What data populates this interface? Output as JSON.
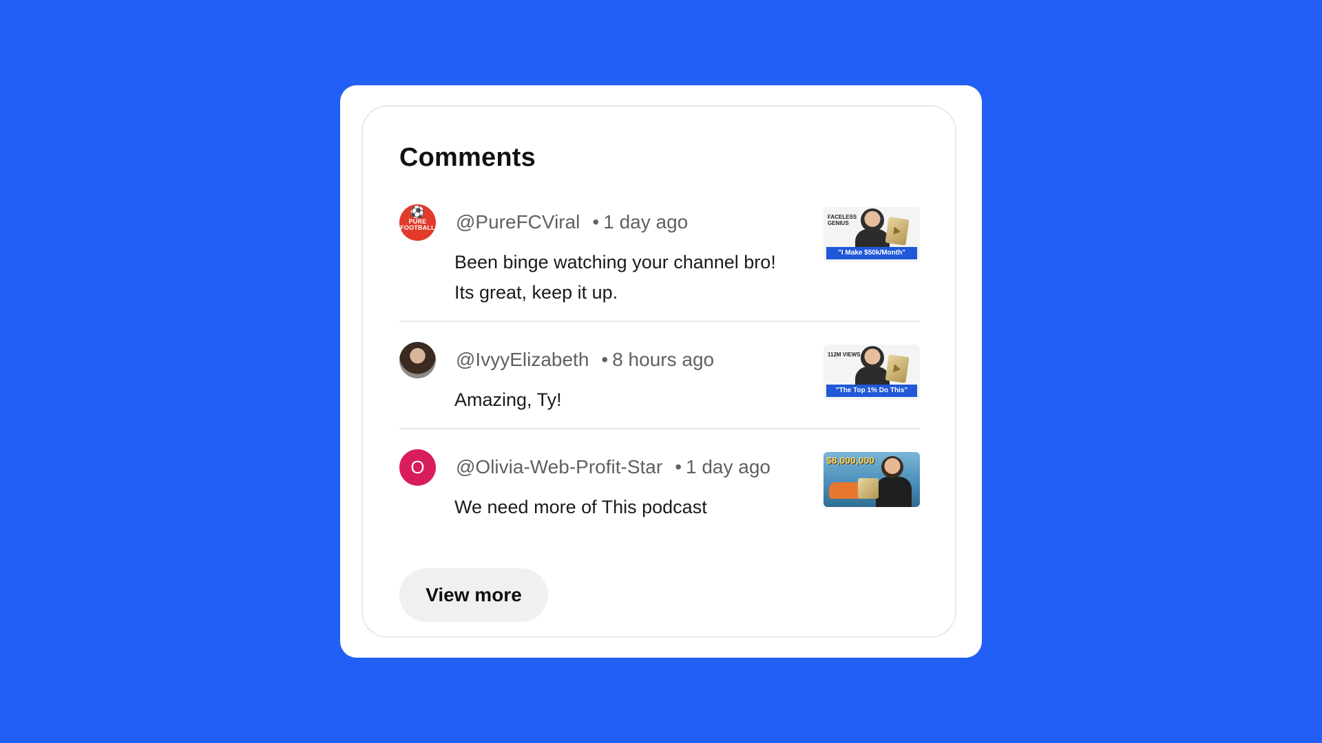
{
  "section": {
    "title": "Comments"
  },
  "comments": [
    {
      "avatar_text": "PURE FOOTBALL",
      "username": "@PureFCViral",
      "separator": "•",
      "time": "1 day ago",
      "lines": [
        "Been binge watching your channel bro!",
        "Its great, keep it up."
      ],
      "thumbnail": {
        "top_text": "FACELESS GENIUS",
        "banner": "\"I Make $50k/Month\""
      }
    },
    {
      "username": "@IvyyElizabeth",
      "separator": "•",
      "time": "8 hours ago",
      "lines": [
        "Amazing, Ty!"
      ],
      "thumbnail": {
        "top_text": "112M VIEWS",
        "banner": "\"The Top 1% Do This\""
      }
    },
    {
      "avatar_text": "O",
      "username": "@Olivia-Web-Profit-Star",
      "separator": "•",
      "time": "1 day ago",
      "lines": [
        "We need more of This podcast"
      ],
      "thumbnail": {
        "top_text": "$8,000,000"
      }
    }
  ],
  "actions": {
    "view_more_label": "View more"
  },
  "colors": {
    "background": "#2260f5",
    "avatar_pure": "#e23a2b",
    "avatar_letter": "#d71d5b",
    "button_bg": "#f0f0f0"
  },
  "icons": [
    "soccer-ball-icon",
    "play-button-icon"
  ]
}
